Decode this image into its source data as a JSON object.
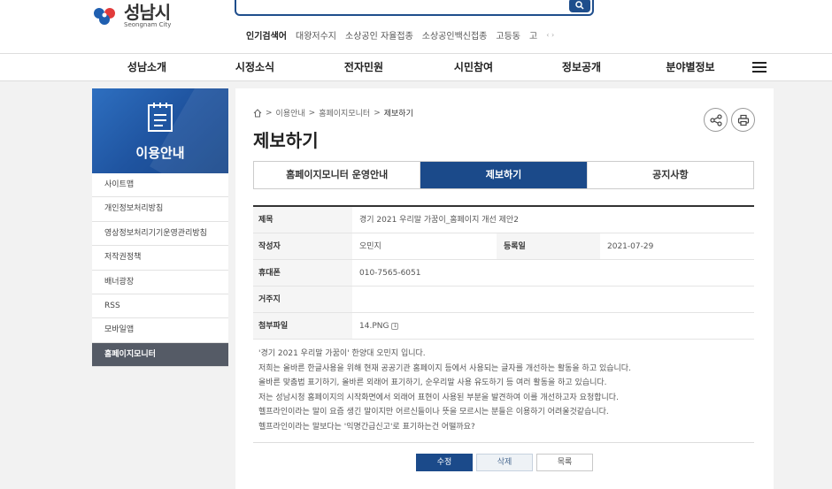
{
  "header": {
    "logo_ko": "성남시",
    "logo_en": "Seongnam City",
    "popular_title": "인기검색어",
    "popular_keywords": [
      "대왕저수지",
      "소상공인 자율접종",
      "소상공인백신접종",
      "고등동",
      "고"
    ],
    "popular_arrows": "‹ ›"
  },
  "gnb": [
    "성남소개",
    "시정소식",
    "전자민원",
    "시민참여",
    "정보공개",
    "분야별정보"
  ],
  "sidebar": {
    "title": "이용안내",
    "items": [
      "사이트맵",
      "개인정보처리방침",
      "영상정보처리기기운영관리방침",
      "저작권정책",
      "배너광장",
      "RSS",
      "모바일앱",
      "홈페이지모니터"
    ]
  },
  "breadcrumb": {
    "home_icon": "home-icon",
    "items": [
      "이용안내",
      "홈페이지모니터",
      "제보하기"
    ],
    "sep": ">"
  },
  "page_title": "제보하기",
  "tabs": [
    "홈페이지모니터 운영안내",
    "제보하기",
    "공지사항"
  ],
  "post": {
    "subject_label": "제목",
    "subject": "경기 2021 우리말 가꿈이_홈페이지 개선 제안2",
    "author_label": "작성자",
    "author": "오민지",
    "date_label": "등록일",
    "date": "2021-07-29",
    "phone_label": "휴대폰",
    "phone": "010-7565-6051",
    "address_label": "거주지",
    "address": "",
    "file_label": "첨부파일",
    "file": "14.PNG",
    "body": [
      "'경기 2021 우리말 가꿈이' 한양대 오민지 입니다.",
      "저희는 올바른 한글사용을 위해 현재 공공기관 홈페이지 등에서 사용되는 글자를 개선하는 활동을 하고 있습니다.",
      "올바른 맞춤법 표기하기, 올바른 외래어 표기하기, 순우리말 사용 유도하기 등 여러 활동을 하고 있습니다.",
      "저는 성남시청 홈페이지의 시작화면에서 외래어 표현이 사용된 부분을 발견하여 이를 개선하고자 요청합니다.",
      "헬프라인이라는 말이 요즘 생긴 말이지만 어르신들이나 뜻을 모르시는 분들은 이용하기 어려울것같습니다.",
      "헬프라인이라는 말보다는 '익명간급신고'로 표기하는건 어떨까요?"
    ]
  },
  "buttons": {
    "edit": "수정",
    "delete": "삭제",
    "list": "목록"
  },
  "colors": {
    "primary": "#1b4a8a",
    "sidebar_active": "#555b66"
  }
}
